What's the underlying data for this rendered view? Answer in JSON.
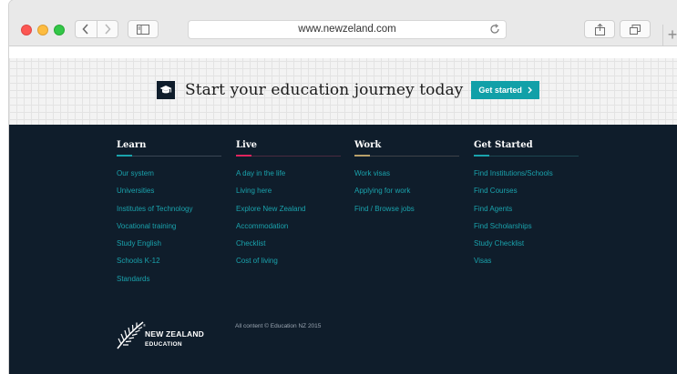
{
  "browser": {
    "url": "www.newzeland.com",
    "icons": {
      "back": "chevron-left-icon",
      "forward": "chevron-right-icon",
      "sidebar": "sidebar-icon",
      "reload": "reload-icon",
      "share": "share-icon",
      "tabs": "tabs-icon",
      "new_tab": "plus-icon"
    }
  },
  "cta": {
    "heading": "Start your education journey today",
    "button_label": "Get started",
    "icon": "graduation-cap-icon",
    "button_color": "#11a0a8"
  },
  "footer": {
    "background": "#0f1d2b",
    "link_color": "#1aa3ad",
    "columns": [
      {
        "title": "Learn",
        "accent": "#1aa3ad",
        "links": [
          "Our system",
          "Universities",
          "Institutes of Technology",
          "Vocational training",
          "Study English",
          "Schools K-12",
          "Standards"
        ]
      },
      {
        "title": "Live",
        "accent": "#e0245e",
        "links": [
          "A day in the life",
          "Living here",
          "Explore New Zealand",
          "Accommodation",
          "Checklist",
          "Cost of living"
        ]
      },
      {
        "title": "Work",
        "accent": "#b8a06a",
        "links": [
          "Work visas",
          "Applying for work",
          "Find / Browse jobs"
        ]
      },
      {
        "title": "Get Started",
        "accent": "#1aa3ad",
        "links": [
          "Find Institutions/Schools",
          "Find Courses",
          "Find Agents",
          "Find Scholarships",
          "Study Checklist",
          "Visas"
        ]
      }
    ],
    "logo": {
      "line1": "NEW ZEALAND",
      "line2": "EDUCATION",
      "mark": "silver-fern-icon"
    },
    "copyright": "All content © Education NZ 2015"
  }
}
